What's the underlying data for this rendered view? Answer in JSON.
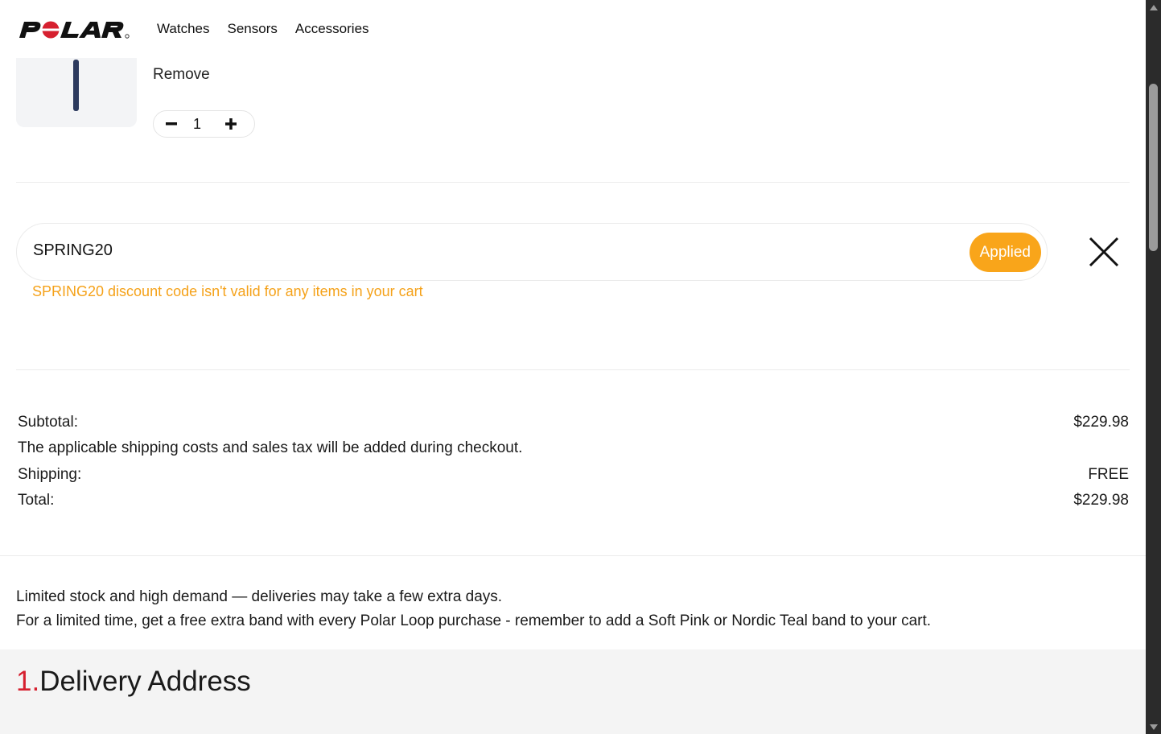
{
  "brand": {
    "logo_text": "POLAR"
  },
  "nav": {
    "items": [
      {
        "label": "Watches"
      },
      {
        "label": "Sensors"
      },
      {
        "label": "Accessories"
      }
    ]
  },
  "cart_item": {
    "remove_label": "Remove",
    "quantity": "1",
    "decrement_symbol": "−",
    "increment_symbol": "+"
  },
  "discount": {
    "code_value": "SPRING20",
    "applied_label": "Applied",
    "message": "SPRING20 discount code isn't valid for any items in your cart",
    "message_color": "#f5a21a",
    "button_color": "#f9a51a"
  },
  "totals": {
    "subtotal_label": "Subtotal:",
    "subtotal_value": "$229.98",
    "shipping_note": "The applicable shipping costs and sales tax will be added during checkout.",
    "shipping_label": "Shipping:",
    "shipping_value": "FREE",
    "total_label": "Total:",
    "total_value": "$229.98"
  },
  "notices": {
    "line1": "Limited stock and high demand — deliveries may take a few extra days.",
    "line2": "For a limited time, get a free extra band with every Polar Loop purchase - remember to add a Soft Pink or Nordic Teal band to your cart."
  },
  "delivery": {
    "step_number": "1.",
    "title": "Delivery Address",
    "accent_color": "#d6202f"
  }
}
